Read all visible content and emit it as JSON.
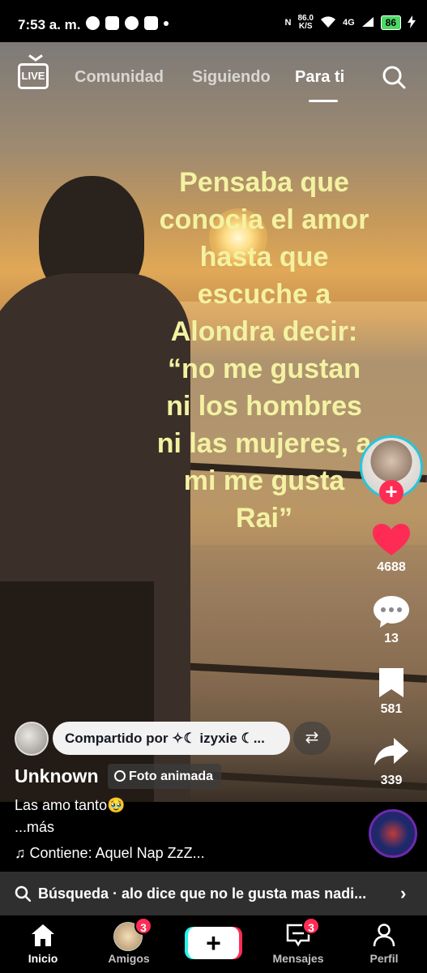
{
  "status_bar": {
    "time": "7:53 a. m.",
    "net_speed_value": "86.0",
    "net_speed_unit": "K/S",
    "network": "4G",
    "battery": "86"
  },
  "top_nav": {
    "live_label": "LIVE",
    "tabs": [
      {
        "label": "Comunidad",
        "active": false
      },
      {
        "label": "Siguiendo",
        "active": false
      },
      {
        "label": "Para ti",
        "active": true
      }
    ],
    "search_icon": "search-icon"
  },
  "video": {
    "overlay_text": "Pensaba que conocia el amor hasta que escuche a Alondra decir: “no me gustan ni los hombres ni las mujeres, a mi me gusta Rai”"
  },
  "right_rail": {
    "likes": "4688",
    "comments": "13",
    "saves": "581",
    "shares": "339",
    "follow_plus": "+",
    "colors": {
      "like": "#fe2c55",
      "avatar_ring": "#26c6da"
    }
  },
  "caption_area": {
    "shared_by": "Compartido por ✧☾ izyxie ☾...",
    "author": "Unknown",
    "photo_tag": "Foto animada",
    "caption": "Las amo tanto🥹",
    "more": "...más",
    "sound": "Contiene: Aquel Nap ZzZ..."
  },
  "search_suggestion": {
    "text": "Búsqueda · alo dice que no le gusta mas nadi..."
  },
  "bottom_nav": {
    "items": [
      {
        "label": "Inicio",
        "active": true
      },
      {
        "label": "Amigos",
        "badge": "3"
      },
      {
        "label": "+"
      },
      {
        "label": "Mensajes",
        "badge": "3"
      },
      {
        "label": "Perfil"
      }
    ]
  }
}
